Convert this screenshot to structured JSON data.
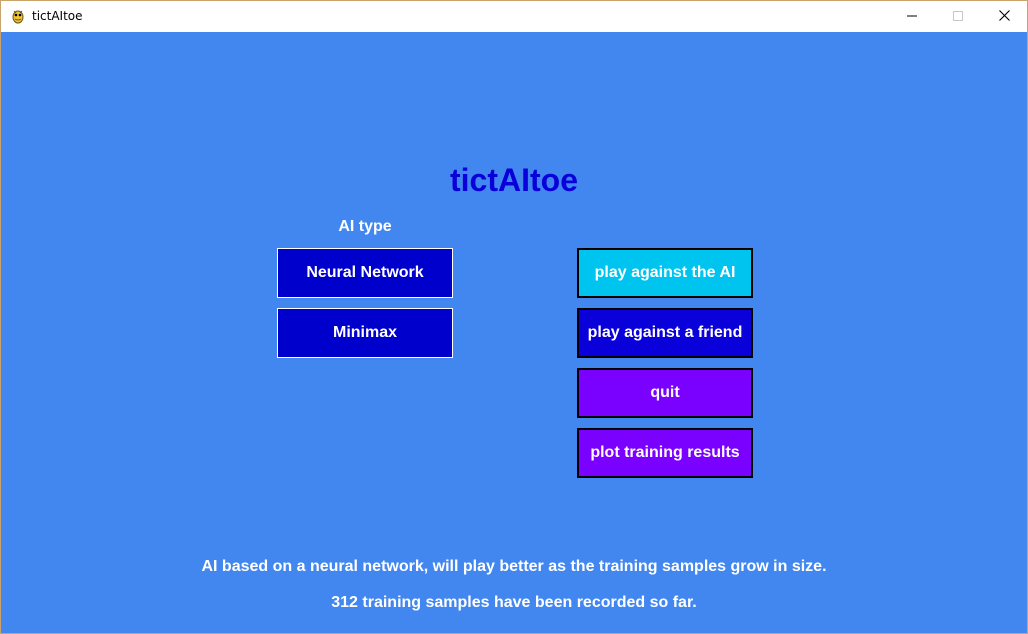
{
  "window": {
    "title": "tictAItoe",
    "icon": "pygame-snake-icon",
    "controls": {
      "minimize": "minimize-icon",
      "maximize": "maximize-icon",
      "close": "close-icon"
    }
  },
  "game": {
    "title": "tictAItoe"
  },
  "ai_type": {
    "label": "AI type",
    "options": [
      {
        "label": "Neural Network",
        "selected": true
      },
      {
        "label": "Minimax",
        "selected": false
      }
    ]
  },
  "menu": {
    "buttons": [
      {
        "label": "play against the AI",
        "color": "#00c4f0"
      },
      {
        "label": "play against a friend",
        "color": "#0a00d9"
      },
      {
        "label": "quit",
        "color": "#7a00ff"
      },
      {
        "label": "plot training results",
        "color": "#7a00ff"
      }
    ]
  },
  "info": {
    "description": "AI based on a neural network, will play better as the training samples grow in size.",
    "samples": "312 training samples have been recorded so far."
  },
  "colors": {
    "background": "#4287f0",
    "title": "#0a00d9",
    "ai_button": "#0000cc"
  }
}
